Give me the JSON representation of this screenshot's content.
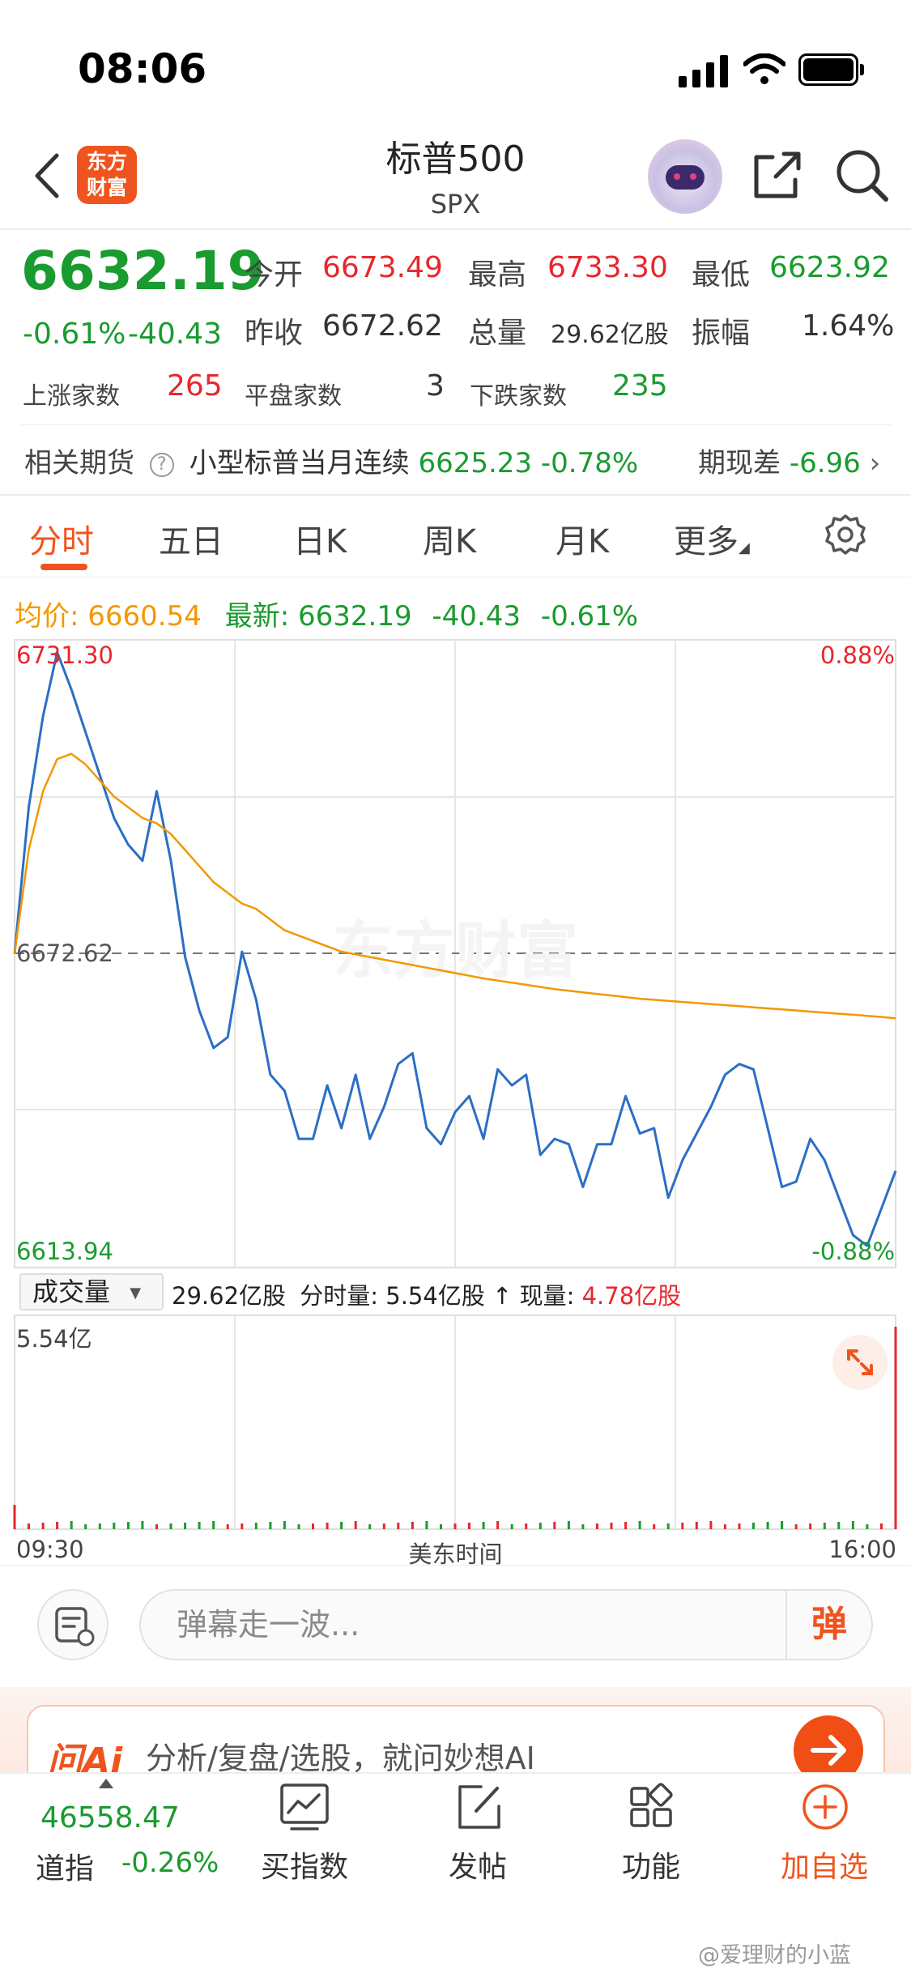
{
  "status_bar": {
    "time": "08:06"
  },
  "header": {
    "title": "标普500",
    "subtitle": "SPX",
    "logo_text": "东方财富"
  },
  "quote": {
    "price": "6632.19",
    "change_pct": "-0.61%",
    "change": "-40.43",
    "open_label": "今开",
    "open": "6673.49",
    "high_label": "最高",
    "high": "6733.30",
    "low_label": "最低",
    "low": "6623.92",
    "prev_close_label": "昨收",
    "prev_close": "6672.62",
    "volume_label": "总量",
    "volume": "29.62亿股",
    "amplitude_label": "振幅",
    "amplitude": "1.64%",
    "up_label": "上涨家数",
    "up_count": "265",
    "flat_label": "平盘家数",
    "flat_count": "3",
    "down_label": "下跌家数",
    "down_count": "235"
  },
  "futures": {
    "label": "相关期货",
    "name": "小型标普当月连续",
    "price": "6625.23",
    "change_pct": "-0.78%",
    "basis_label": "期现差",
    "basis": "-6.96"
  },
  "tabs": [
    "分时",
    "五日",
    "日K",
    "周K",
    "月K",
    "更多"
  ],
  "chart_info": {
    "avg_label": "均价:",
    "avg": "6660.54",
    "latest_label": "最新:",
    "latest": "6632.19",
    "change": "-40.43",
    "change_pct": "-0.61%",
    "top_price": "6731.30",
    "top_pct": "0.88%",
    "mid_price": "6672.62",
    "bottom_price": "6613.94",
    "bottom_pct": "-0.88%",
    "watermark": "东方财富"
  },
  "volume": {
    "selector": "成交量",
    "total": "29.62亿股",
    "minute_label": "分时量:",
    "minute": "5.54亿股",
    "arrow": "↑",
    "current_label": "现量:",
    "current": "4.78亿股",
    "max_label": "5.54亿",
    "start_time": "09:30",
    "axis_label": "美东时间",
    "end_time": "16:00"
  },
  "comment": {
    "placeholder": "弹幕走一波...",
    "danmu_button": "弹"
  },
  "ai": {
    "logo": "问Ai",
    "text": "分析/复盘/选股，就问妙想AI"
  },
  "bottom_nav": {
    "index_value": "46558.47",
    "index_name": "道指",
    "index_change": "-0.26%",
    "items": [
      "买指数",
      "发帖",
      "功能",
      "加自选"
    ]
  },
  "watermark": "@爱理财的小蓝",
  "chart_data": {
    "type": "line",
    "title": "",
    "xlabel": "美东时间",
    "ylabel": "",
    "xlim": [
      "09:30",
      "16:00"
    ],
    "ylim": [
      6613.94,
      6731.3
    ],
    "reference": 6672.62,
    "series": [
      {
        "name": "最新",
        "color": "#2a6fc4",
        "values": [
          6672.6,
          6700,
          6717,
          6729,
          6722,
          6714,
          6706,
          6698,
          6693,
          6690,
          6703,
          6690,
          6672,
          6662,
          6655,
          6657,
          6673,
          6664,
          6650,
          6647,
          6638,
          6638,
          6648,
          6640,
          6650,
          6638,
          6644,
          6652,
          6654,
          6640,
          6637,
          6643,
          6646,
          6638,
          6651,
          6648,
          6650,
          6635,
          6638,
          6637,
          6629,
          6637,
          6637,
          6646,
          6639,
          6640,
          6627,
          6634,
          6639,
          6644,
          6650,
          6652,
          6651,
          6640,
          6629,
          6630,
          6638,
          6634,
          6627,
          6620,
          6618,
          6625,
          6632
        ]
      },
      {
        "name": "均价",
        "color": "#f39800",
        "values": [
          6672.6,
          6692,
          6703,
          6709,
          6710,
          6708,
          6705,
          6702,
          6700,
          6698,
          6697,
          6695,
          6692,
          6689,
          6686,
          6684,
          6682,
          6681,
          6679,
          6677,
          6676,
          6675,
          6674,
          6673,
          6672.5,
          6672,
          6671.5,
          6671,
          6670.5,
          6670,
          6669.5,
          6669,
          6668.5,
          6668,
          6667.6,
          6667.2,
          6666.8,
          6666.4,
          6666,
          6665.7,
          6665.4,
          6665.1,
          6664.8,
          6664.5,
          6664.2,
          6664,
          6663.8,
          6663.6,
          6663.4,
          6663.2,
          6663,
          6662.8,
          6662.6,
          6662.4,
          6662.2,
          6662,
          6661.8,
          6661.6,
          6661.4,
          6661.2,
          6661,
          6660.8,
          6660.54
        ]
      }
    ]
  }
}
